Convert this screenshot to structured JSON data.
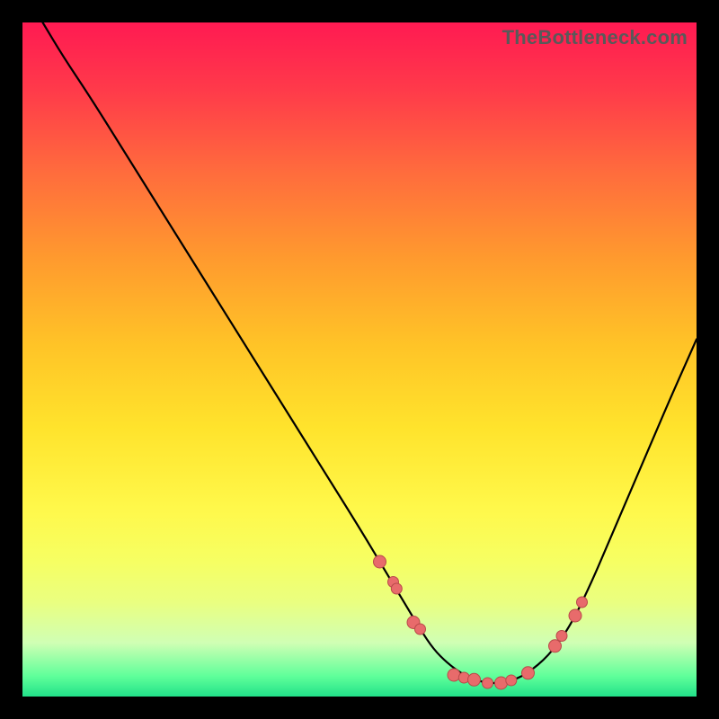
{
  "watermark": "TheBottleneck.com",
  "colors": {
    "gradient_top": "#ff1a52",
    "gradient_bottom": "#22e189",
    "curve": "#000000",
    "dot_fill": "#e86b6b",
    "dot_stroke": "#b94a4a",
    "frame_bg": "#000000"
  },
  "chart_data": {
    "type": "line",
    "title": "",
    "xlabel": "",
    "ylabel": "",
    "xlim": [
      0,
      100
    ],
    "ylim": [
      0,
      100
    ],
    "note": "x is horizontal position as % of plot width (0=left,100=right); y is the curve height as % of plot height (0=bottom,100=top). Background hue encodes y (red≈high bottleneck, green≈low).",
    "series": [
      {
        "name": "bottleneck-curve",
        "x": [
          3,
          6,
          10,
          15,
          20,
          25,
          30,
          35,
          40,
          45,
          50,
          53,
          56,
          59,
          61,
          63,
          65,
          67,
          69,
          71,
          73,
          75,
          78,
          81,
          84,
          87,
          90,
          93,
          96,
          100
        ],
        "y": [
          100,
          95,
          89,
          81,
          73,
          65,
          57,
          49,
          41,
          33,
          25,
          20,
          15,
          10,
          7,
          5,
          3.5,
          2.5,
          2,
          2,
          2.5,
          3.5,
          6,
          10,
          16,
          23,
          30,
          37,
          44,
          53
        ]
      }
    ],
    "markers": {
      "name": "highlight-dots",
      "x": [
        53,
        55,
        55.5,
        58,
        59,
        64,
        65.5,
        67,
        69,
        71,
        72.5,
        75,
        79,
        80,
        82,
        83
      ],
      "y": [
        20,
        17,
        16,
        11,
        10,
        3.2,
        2.8,
        2.5,
        2,
        2,
        2.4,
        3.5,
        7.5,
        9,
        12,
        14
      ],
      "r": [
        7,
        6,
        6,
        7,
        6,
        7,
        6,
        7,
        6,
        7,
        6,
        7,
        7,
        6,
        7,
        6
      ]
    }
  }
}
